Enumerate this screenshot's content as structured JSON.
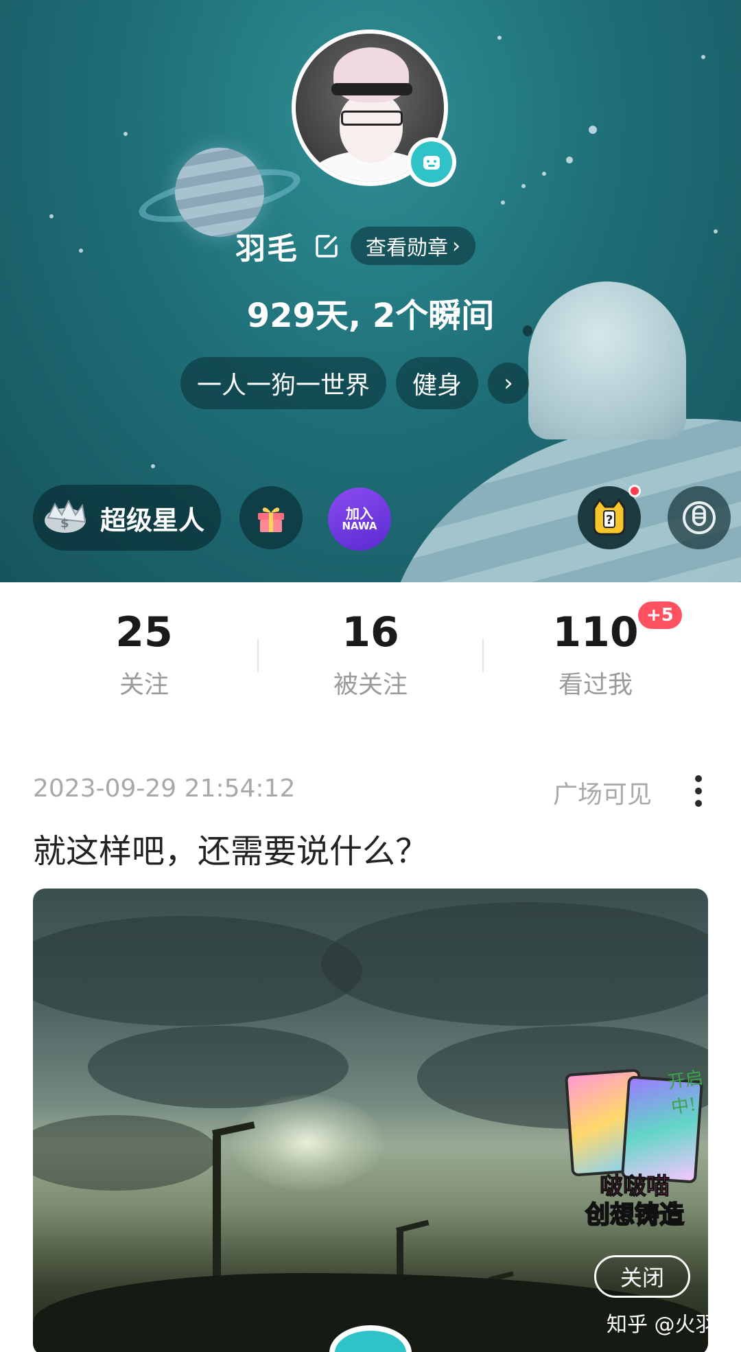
{
  "profile": {
    "name": "羽毛",
    "medal_button": "查看勋章",
    "days_line": "929天, 2个瞬间",
    "tags": [
      "一人一狗一世界",
      "健身"
    ],
    "super_star": "超级星人",
    "nawa": {
      "line1": "加入",
      "line2": "NAWA"
    }
  },
  "stats": [
    {
      "value": "25",
      "label": "关注"
    },
    {
      "value": "16",
      "label": "被关注"
    },
    {
      "value": "110",
      "label": "看过我"
    }
  ],
  "visitors_new_badge": "+5",
  "post": {
    "timestamp": "2023-09-29 21:54:12",
    "visibility": "广场可见",
    "text": "就这样吧，还需要说什么？"
  },
  "promo": {
    "title_top": "啵啵喵",
    "title_bottom": "创想铸造",
    "corner_note": "开启中!",
    "close_label": "关闭"
  },
  "watermark": "知乎 @火羽",
  "colors": {
    "banner": "#1f6f78",
    "accent_teal": "#2fc2c7",
    "badge_red": "#ff5261",
    "nawa_purple": "#6a36de"
  },
  "icons": {
    "edit": "edit-icon",
    "gift": "gift-icon",
    "cat_question": "cat-question-icon",
    "mic": "voice-icon",
    "more": "more-vertical-icon"
  }
}
